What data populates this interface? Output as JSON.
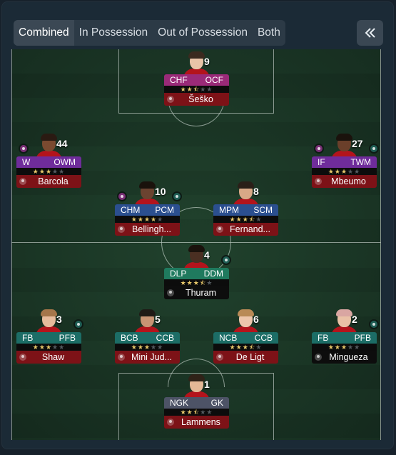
{
  "tabs": [
    "Combined",
    "In Possession",
    "Out of Possession",
    "Both"
  ],
  "active_tab": "Combined",
  "collapse_icon": "double-chevron-left-icon",
  "colors": {
    "name_red": "#7d1217",
    "name_black": "#0d0d0d",
    "stars_on": "#e7c76a",
    "pitch": "#1e3d2b"
  },
  "players": [
    {
      "id": "sesko",
      "number": "9",
      "roles": [
        "CHF",
        "OCF"
      ],
      "stars": 2.5,
      "name": "Šeško",
      "role_color": "r-pink",
      "name_color": "c-red",
      "badges": []
    },
    {
      "id": "barcola",
      "number": "44",
      "roles": [
        "W",
        "OWM"
      ],
      "stars": 3,
      "name": "Barcola",
      "role_color": "r-purple",
      "name_color": "c-red",
      "badges": [
        "left"
      ]
    },
    {
      "id": "mbeumo",
      "number": "27",
      "roles": [
        "IF",
        "TWM"
      ],
      "stars": 3,
      "name": "Mbeumo",
      "role_color": "r-purple",
      "name_color": "c-red",
      "badges": [
        "left",
        "right"
      ]
    },
    {
      "id": "bellingham",
      "number": "10",
      "roles": [
        "CHM",
        "PCM"
      ],
      "stars": 4,
      "name": "Bellingh...",
      "role_color": "r-blue",
      "name_color": "c-red",
      "badges": [
        "left",
        "right"
      ]
    },
    {
      "id": "fernandes",
      "number": "8",
      "roles": [
        "MPM",
        "SCM"
      ],
      "stars": 3.5,
      "name": "Fernand...",
      "role_color": "r-blue",
      "name_color": "c-red",
      "badges": []
    },
    {
      "id": "thuram",
      "number": "4",
      "roles": [
        "DLP",
        "DDM"
      ],
      "stars": 3.5,
      "name": "Thuram",
      "role_color": "r-green",
      "name_color": "c-black",
      "badges": [
        "right"
      ]
    },
    {
      "id": "shaw",
      "number": "3",
      "roles": [
        "FB",
        "PFB"
      ],
      "stars": 3,
      "name": "Shaw",
      "role_color": "r-teal",
      "name_color": "c-red",
      "badges": [
        "right"
      ]
    },
    {
      "id": "mini-jud",
      "number": "5",
      "roles": [
        "BCB",
        "CCB"
      ],
      "stars": 3,
      "name": "Mini Jud...",
      "role_color": "r-teal",
      "name_color": "c-red",
      "badges": []
    },
    {
      "id": "de-ligt",
      "number": "6",
      "roles": [
        "NCB",
        "CCB"
      ],
      "stars": 3.5,
      "name": "De Ligt",
      "role_color": "r-teal",
      "name_color": "c-red",
      "badges": []
    },
    {
      "id": "mingueza",
      "number": "2",
      "roles": [
        "FB",
        "PFB"
      ],
      "stars": 3,
      "name": "Mingueza",
      "role_color": "r-teal",
      "name_color": "c-black",
      "badges": [
        "right"
      ]
    },
    {
      "id": "lammens",
      "number": "1",
      "roles": [
        "NGK",
        "GK"
      ],
      "stars": 2.5,
      "name": "Lammens",
      "role_color": "r-grey",
      "name_color": "c-red",
      "badges": []
    }
  ]
}
